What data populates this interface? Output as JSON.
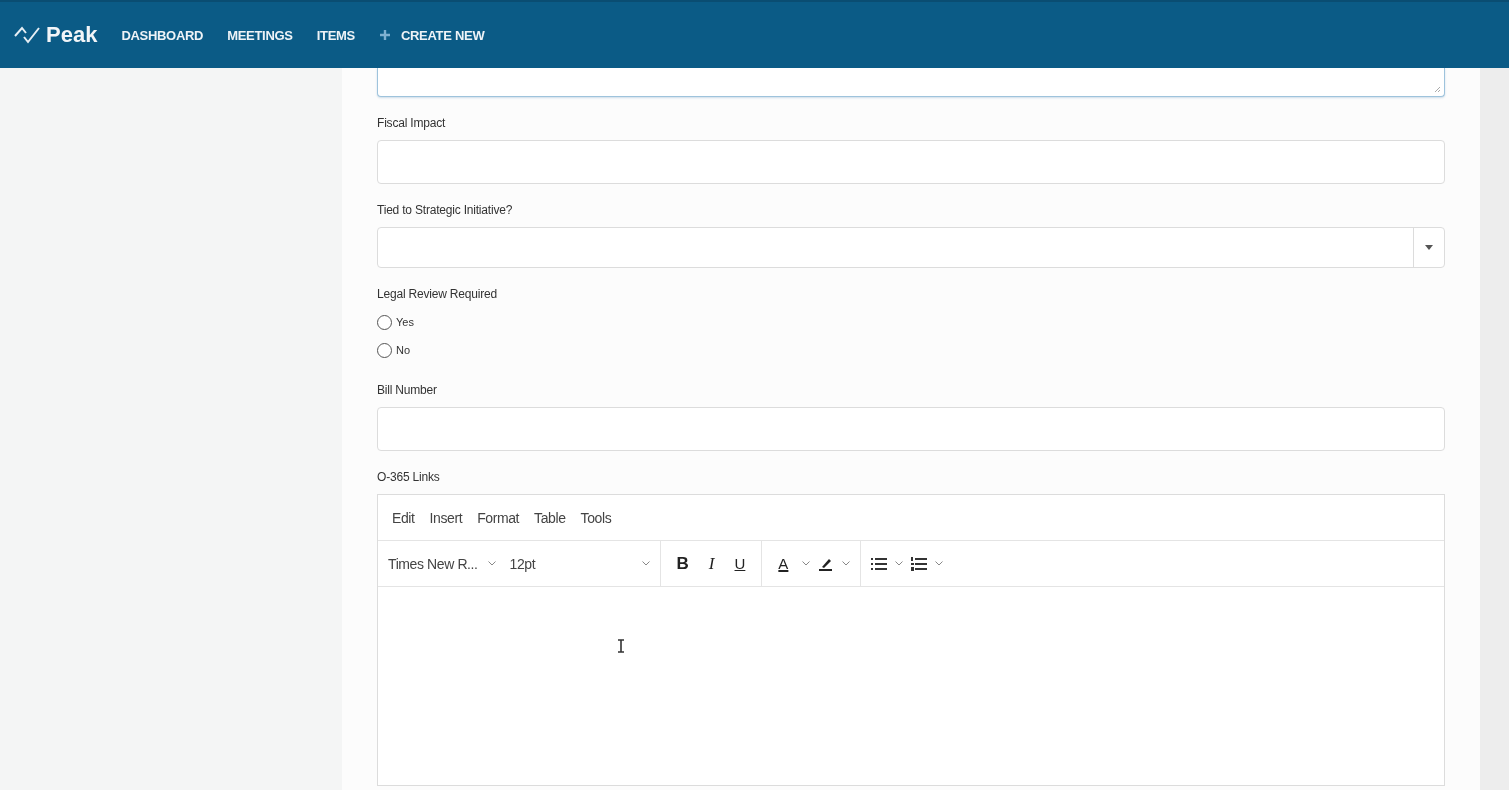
{
  "nav": {
    "brand": "Peak",
    "items": [
      {
        "label": "DASHBOARD",
        "kind": "link"
      },
      {
        "label": "MEETINGS",
        "kind": "link"
      },
      {
        "label": "ITEMS",
        "kind": "link"
      },
      {
        "label": "CREATE NEW",
        "kind": "create"
      }
    ]
  },
  "form": {
    "fields": [
      {
        "kind": "textarea"
      },
      {
        "kind": "text",
        "label": "Fiscal Impact"
      },
      {
        "kind": "select",
        "label": "Tied to Strategic Initiative?"
      },
      {
        "kind": "radio",
        "label": "Legal Review Required",
        "options": [
          {
            "label": "Yes",
            "selected": false
          },
          {
            "label": "No",
            "selected": false
          }
        ]
      },
      {
        "kind": "text",
        "label": "Bill Number"
      },
      {
        "kind": "editor",
        "label": "O-365 Links",
        "menu": [
          "Edit",
          "Insert",
          "Format",
          "Table",
          "Tools"
        ],
        "font": "Times New R...",
        "size": "12pt",
        "format_buttons": [
          {
            "label": "B",
            "kind": "bold"
          },
          {
            "label": "I",
            "kind": "italic"
          },
          {
            "label": "U",
            "kind": "underline"
          }
        ],
        "color_button": {
          "label": "A"
        }
      }
    ]
  }
}
